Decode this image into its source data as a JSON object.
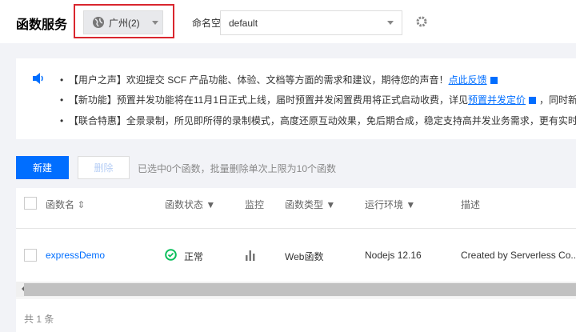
{
  "header": {
    "title": "函数服务",
    "region": "广州(2)",
    "namespace_label": "命名空间:",
    "namespace": "default"
  },
  "notice": [
    {
      "tag": "【用户之声】",
      "text": "欢迎提交 SCF 产品功能、体验、文档等方面的需求和建议，期待您的声音！",
      "link": "点此反馈",
      "after": ""
    },
    {
      "tag": "【新功能】",
      "text": "预置并发功能将在11月1日正式上线，届时预置并发闲置费用将正式启动收费，详见",
      "link": "预置并发定价",
      "after": "，同时新"
    },
    {
      "tag": "【联合特惠】",
      "text": "全景录制，所见即所得的录制模式，高度还原互动效果，免后期合成，稳定支持高并发业务需求，更有实时",
      "link": "",
      "after": ""
    }
  ],
  "toolbar": {
    "new": "新建",
    "delete": "删除",
    "hint": "已选中0个函数，批量删除单次上限为10个函数"
  },
  "table": {
    "columns": [
      "函数名",
      "函数状态",
      "监控",
      "函数类型",
      "运行环境",
      "描述"
    ],
    "rows": [
      {
        "name": "expressDemo",
        "status": "正常",
        "type": "Web函数",
        "runtime": "Nodejs 12.16",
        "desc": "Created by Serverless Co..."
      }
    ],
    "footer": "共 1 条"
  },
  "colors": {
    "accent": "#006eff",
    "success": "#0abf5b",
    "highlight": "#d9262e"
  }
}
